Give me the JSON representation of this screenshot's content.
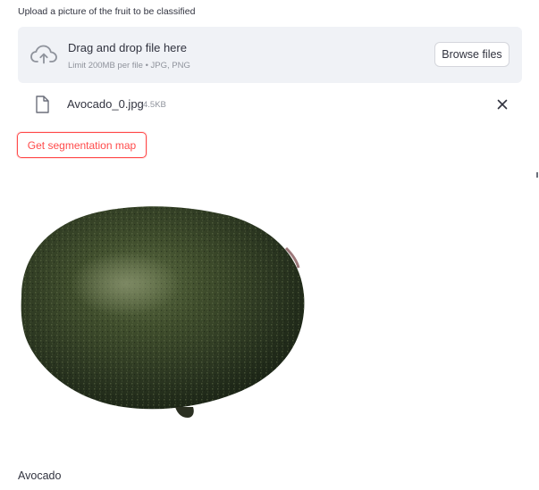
{
  "uploader": {
    "label": "Upload a picture of the fruit to be classified",
    "dropzone_title": "Drag and drop file here",
    "dropzone_subtitle": "Limit 200MB per file • JPG, PNG",
    "browse_label": "Browse files",
    "cloud_icon": "cloud-upload-icon"
  },
  "uploaded_file": {
    "name": "Avocado_0.jpg",
    "size": "4.5KB",
    "file_icon": "file-icon",
    "remove_icon": "close-icon"
  },
  "actions": {
    "segmentation_button": "Get segmentation map",
    "accent_color": "#ff4b4b"
  },
  "image": {
    "subject": "avocado photo"
  },
  "prediction": {
    "label": "Avocado"
  }
}
